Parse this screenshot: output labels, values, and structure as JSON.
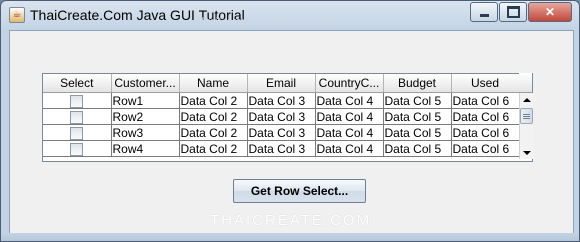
{
  "window": {
    "title": "ThaiCreate.Com Java GUI Tutorial",
    "title_watermark": "ThaiCreate.Com Java GUI Tutorial",
    "bottom_watermark": "THAICREATE.COM"
  },
  "table": {
    "columns": [
      "Select",
      "Customer...",
      "Name",
      "Email",
      "CountryC...",
      "Budget",
      "Used"
    ],
    "rows": [
      {
        "selected": false,
        "cells": [
          "Row1",
          "Data Col 2",
          "Data Col 3",
          "Data Col 4",
          "Data Col 5",
          "Data Col 6"
        ]
      },
      {
        "selected": false,
        "cells": [
          "Row2",
          "Data Col 2",
          "Data Col 3",
          "Data Col 4",
          "Data Col 5",
          "Data Col 6"
        ]
      },
      {
        "selected": false,
        "cells": [
          "Row3",
          "Data Col 2",
          "Data Col 3",
          "Data Col 4",
          "Data Col 5",
          "Data Col 6"
        ]
      },
      {
        "selected": false,
        "cells": [
          "Row4",
          "Data Col 2",
          "Data Col 3",
          "Data Col 4",
          "Data Col 5",
          "Data Col 6"
        ]
      }
    ]
  },
  "button": {
    "label": "Get Row Select..."
  },
  "icons": {
    "app": "java-cup-icon",
    "minimize": "minimize-icon",
    "maximize": "maximize-icon",
    "close": "close-icon"
  }
}
